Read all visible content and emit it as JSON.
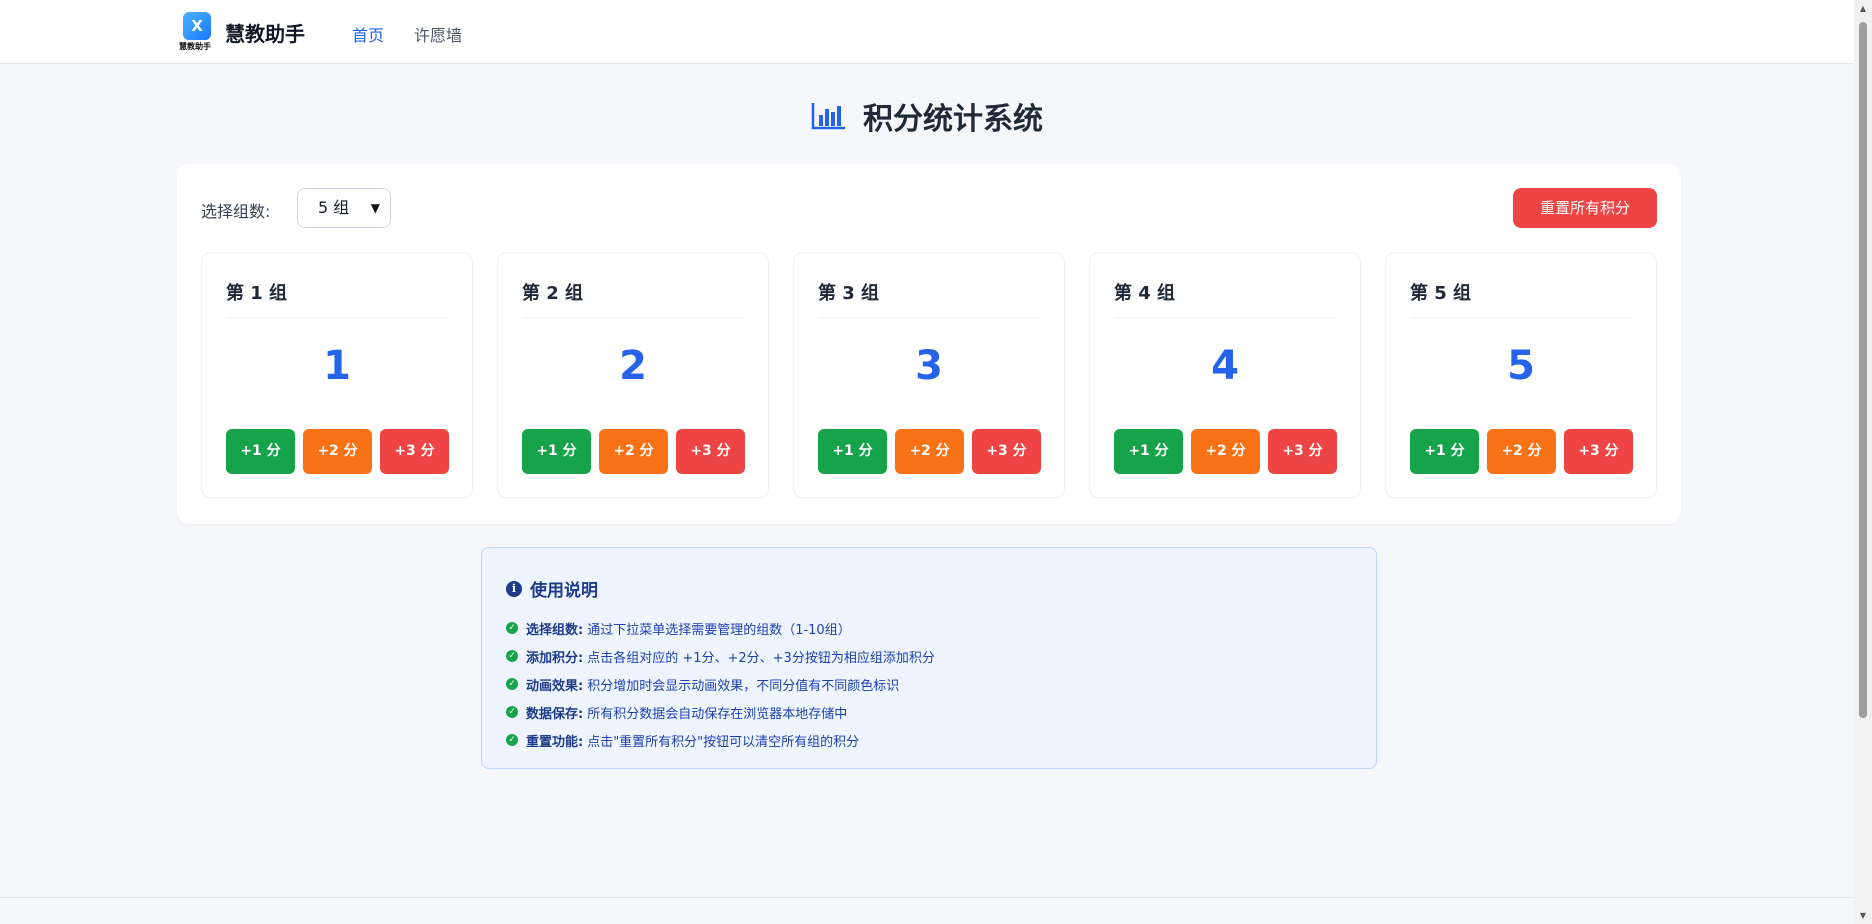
{
  "header": {
    "logo_mark": "X",
    "logo_sub": "慧教助手",
    "brand_name": "慧教助手",
    "nav": [
      {
        "label": "首页",
        "active": true
      },
      {
        "label": "许愿墙",
        "active": false
      }
    ]
  },
  "page": {
    "title": "积分统计系统",
    "title_icon": "bar-chart-icon"
  },
  "controls": {
    "select_label": "选择组数:",
    "select_value": "5 组",
    "reset_label": "重置所有积分"
  },
  "groups": [
    {
      "name": "第 1 组",
      "score": "1"
    },
    {
      "name": "第 2 组",
      "score": "2"
    },
    {
      "name": "第 3 组",
      "score": "3"
    },
    {
      "name": "第 4 组",
      "score": "4"
    },
    {
      "name": "第 5 组",
      "score": "5"
    }
  ],
  "score_buttons": {
    "plus1": "+1 分",
    "plus2": "+2 分",
    "plus3": "+3 分"
  },
  "instructions": {
    "title": "使用说明",
    "items": [
      {
        "key": "选择组数:",
        "text": "通过下拉菜单选择需要管理的组数（1-10组）"
      },
      {
        "key": "添加积分:",
        "text": "点击各组对应的 +1分、+2分、+3分按钮为相应组添加积分"
      },
      {
        "key": "动画效果:",
        "text": "积分增加时会显示动画效果，不同分值有不同颜色标识"
      },
      {
        "key": "数据保存:",
        "text": "所有积分数据会自动保存在浏览器本地存储中"
      },
      {
        "key": "重置功能:",
        "text": "点击\"重置所有积分\"按钮可以清空所有组的积分"
      }
    ]
  },
  "colors": {
    "accent": "#2563eb",
    "plus1": "#16a34a",
    "plus2": "#f97316",
    "plus3": "#ef4444"
  }
}
